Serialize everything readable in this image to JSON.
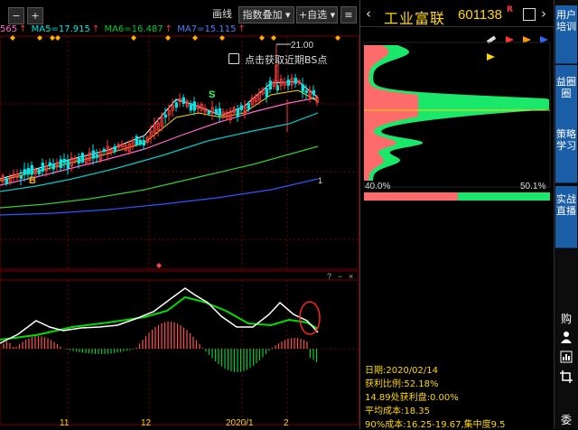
{
  "toolbar": {
    "draw_label": "画线",
    "overlay_label": "指数叠加",
    "watchlist_label": "+自选",
    "minus_label": "−",
    "plus_label": "+",
    "menu_label": "≡"
  },
  "ma_line": {
    "partial": "565",
    "ma5": "MA5=17.915",
    "ma6": "MA6=16.487",
    "ma7": "MA7=15.115"
  },
  "chart": {
    "high_label": "21.00",
    "bs_hint": "点击获取近期BS点",
    "s_marker": "S",
    "b_marker": "B",
    "level_marker": "1",
    "x_labels": [
      "11",
      "12",
      "2020/1",
      "2"
    ],
    "lower_question": "?",
    "lower_minus": "−",
    "lower_close": "×"
  },
  "stock": {
    "name": "工业富联",
    "code": "601138",
    "badge": "R"
  },
  "profile": {
    "left_pct": "40.0%",
    "right_pct": "50.1%",
    "bar_split": 0.505
  },
  "info": {
    "date": "日期:2020/02/14",
    "profit_ratio": "获利比例:52.18%",
    "profit_at": "14.89处获利盘:0.00%",
    "avg_cost": "平均成本:18.35",
    "cost90": "90%成本:16.25-19.67,集中度9.5"
  },
  "tabs": [
    {
      "label": "用户培训"
    },
    {
      "label": "益圈圈"
    },
    {
      "label": "策略学习"
    },
    {
      "label": "实战直播"
    }
  ],
  "side_actions": {
    "buy": "购",
    "more": "委"
  },
  "colors": {
    "up": "#ff3b3b",
    "down": "#00e5e5",
    "ma_white": "#ffffff",
    "ma_yellow": "#ffd700",
    "ma_pink": "#ff66cc",
    "macd_green": "#00cc33",
    "tab_blue": "#1b5ea8"
  }
}
